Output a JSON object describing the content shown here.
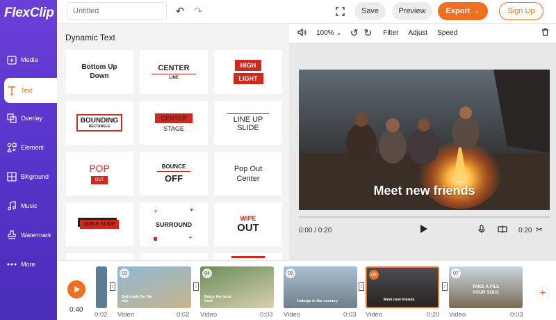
{
  "app": {
    "logo": "FlexClip",
    "project_placeholder": "Untitled"
  },
  "sidebar": {
    "items": [
      {
        "label": "Media",
        "icon": "media-icon"
      },
      {
        "label": "Text",
        "icon": "text-icon",
        "active": true
      },
      {
        "label": "Overlay",
        "icon": "overlay-icon"
      },
      {
        "label": "Element",
        "icon": "element-icon"
      },
      {
        "label": "BKground",
        "icon": "background-icon"
      },
      {
        "label": "Music",
        "icon": "music-icon"
      },
      {
        "label": "Watermark",
        "icon": "watermark-icon"
      },
      {
        "label": "More",
        "icon": "more-icon"
      }
    ]
  },
  "topbar": {
    "save": "Save",
    "preview": "Preview",
    "export": "Export →",
    "signup": "Sign Up"
  },
  "panel": {
    "title": "Dynamic Text",
    "cards": {
      "c1": "Bottom Up Down",
      "c2a": "CENTER",
      "c2b": "LINE",
      "c3a": "HIGH",
      "c3b": "LIGHT",
      "c4a": "BOUNDING",
      "c4b": "RECTANGLE",
      "c5a": "CENTER",
      "c5b": "STAGE",
      "c6a": "LINE UP",
      "c6b": "SLIDE",
      "c7a": "POP",
      "c7b": "OUT",
      "c8a": "BOUNCE",
      "c8b": "OFF",
      "c9a": "Pop Out",
      "c9b": "Center",
      "c10": "QUICK SLIDE",
      "c11": "SURROUND",
      "c12a": "WIPE",
      "c12b": "OUT"
    }
  },
  "player": {
    "zoom": "100%",
    "filter": "Filter",
    "adjust": "Adjust",
    "speed": "Speed",
    "caption": "Meet new friends",
    "time": "0:00 / 0:20",
    "duration": "0:20"
  },
  "timeline": {
    "current": "0:40",
    "clips": [
      {
        "num": "03",
        "text": "Get ready for the trip",
        "label": "Video",
        "dur": "0:02"
      },
      {
        "num": "04",
        "text": "Enjoy the local food",
        "label": "Video",
        "dur": "0:03"
      },
      {
        "num": "05",
        "text": "Indulge in the scenery",
        "label": "Video",
        "dur": "0:03"
      },
      {
        "num": "06",
        "text": "Meet new friends",
        "label": "Video",
        "dur": "0:20"
      },
      {
        "num": "07",
        "text": "TAKE A FILL YOUR SOUL",
        "label": "Video",
        "dur": "0:03"
      }
    ],
    "prev_dur": "0:02"
  },
  "colors": {
    "accent": "#f07023",
    "sidebar": "#5a36cc",
    "red": "#cc2a1e"
  }
}
